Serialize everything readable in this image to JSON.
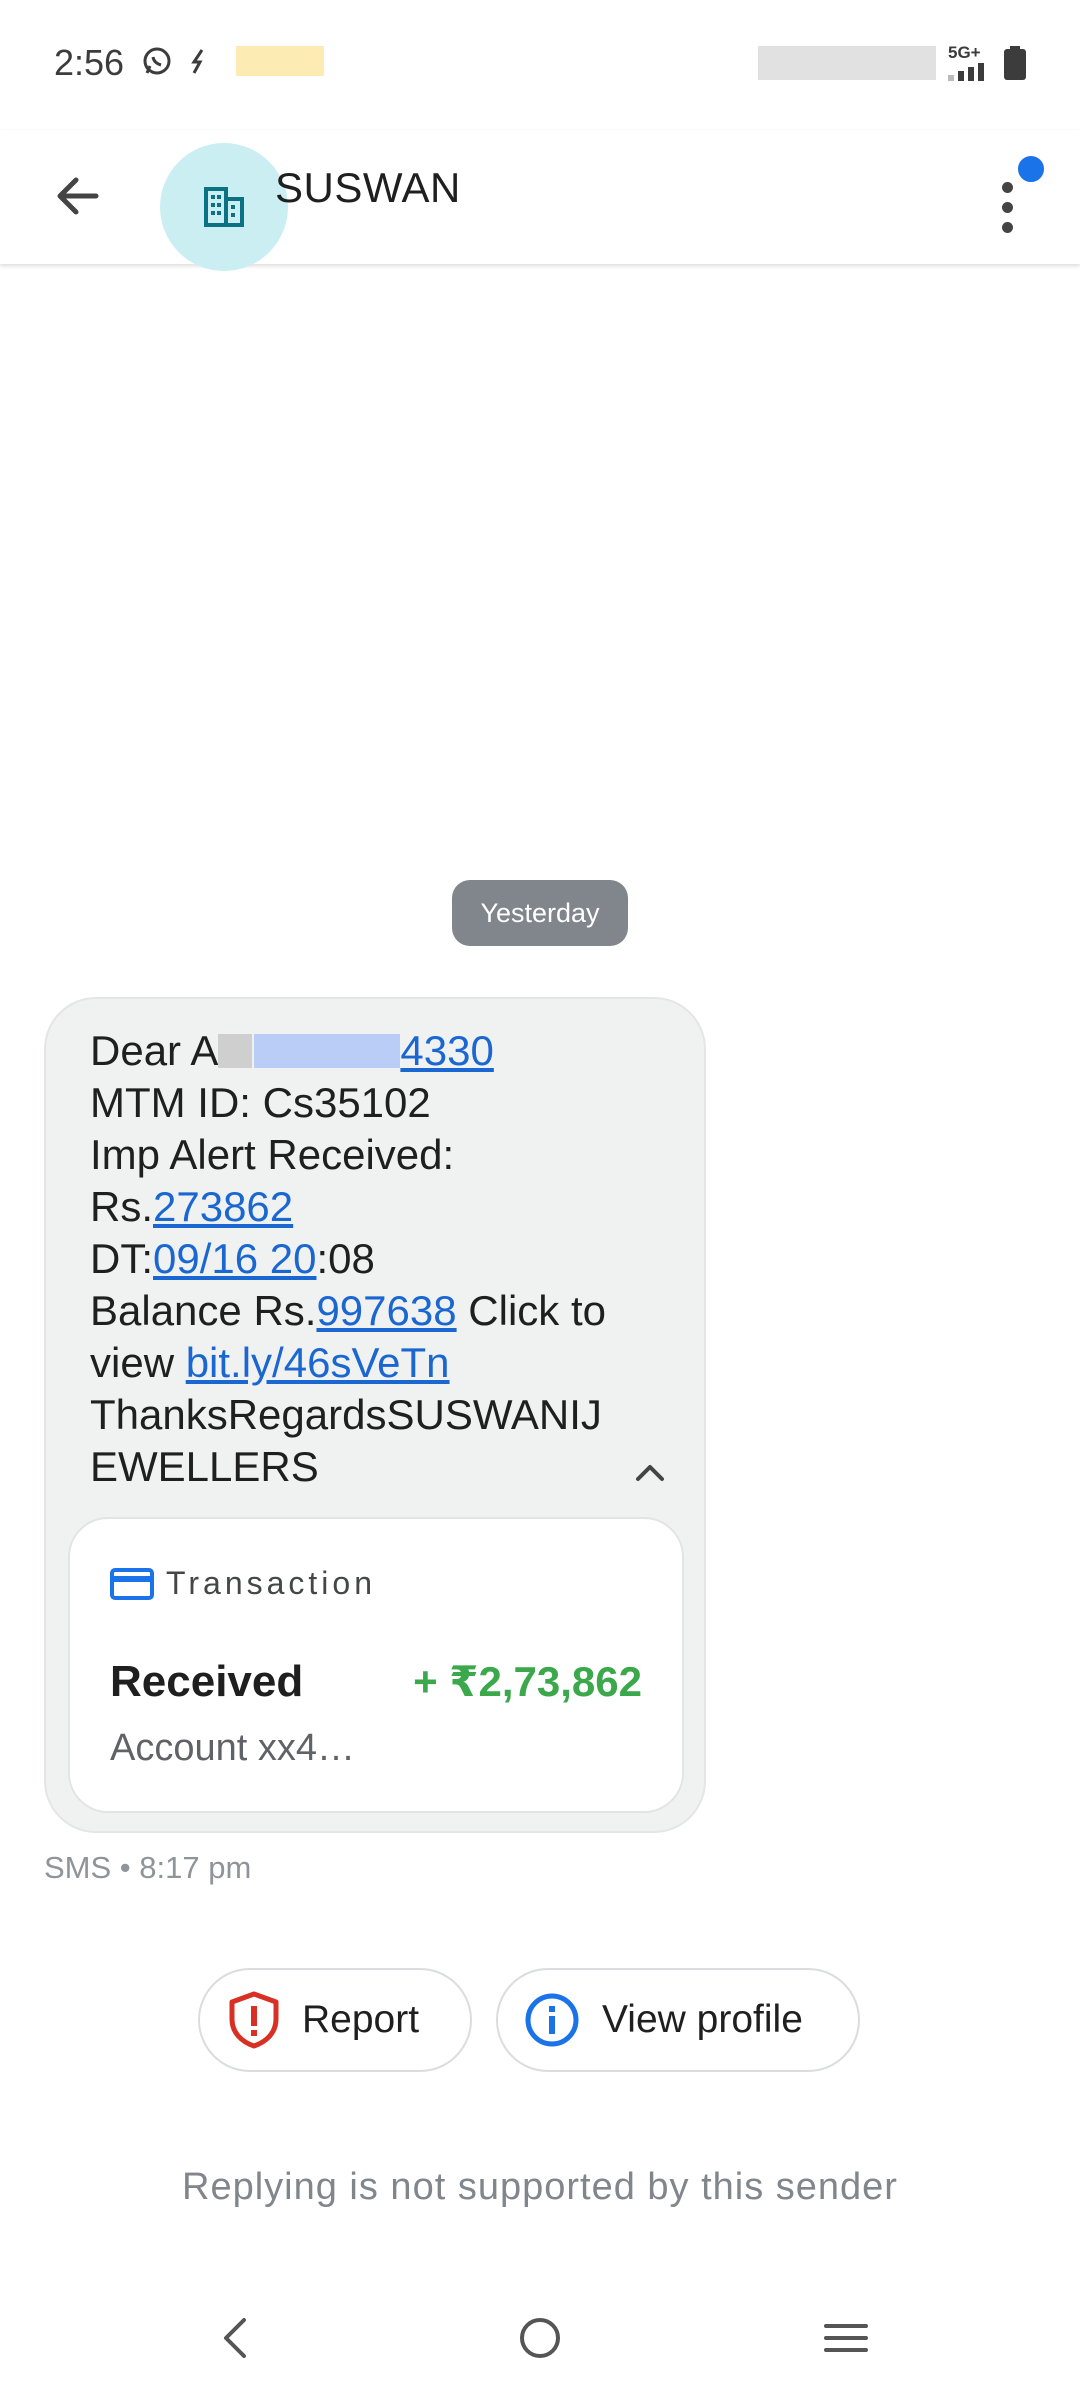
{
  "status_bar": {
    "time": "2:56",
    "network": "5G+",
    "icons": [
      "whatsapp-icon",
      "notification-icon",
      "signal-icon",
      "battery-icon"
    ]
  },
  "app_bar": {
    "title": "SUSWAN",
    "icons": [
      "back-arrow-icon",
      "business-icon",
      "more-vert-icon"
    ]
  },
  "conversation": {
    "date_chip": "Yesterday",
    "message": {
      "line1_prefix": "Dear A",
      "line1_link": "4330",
      "line2": "MTM ID: Cs35102",
      "line3": "Imp Alert Received:",
      "line4_prefix": "Rs.",
      "line4_link": "273862",
      "line5_prefix": "DT:",
      "line5_link": "09/16 20",
      "line5_suffix": ":08",
      "line6_prefix": "Balance Rs.",
      "line6_link": "997638",
      "line6_suffix": " Click to",
      "line7_prefix": "view ",
      "line7_link": "bit.ly/46sVeTn",
      "line8": "ThanksRegardsSUSWANIJ",
      "line9": "EWELLERS"
    },
    "card": {
      "title": "Transaction",
      "type": "Received",
      "amount": "+ ₹2,73,862",
      "account": "Account xx4…"
    },
    "meta": "SMS • 8:17 pm"
  },
  "actions": {
    "report": "Report",
    "view_profile": "View profile"
  },
  "footer_note": "Replying is not supported by this sender",
  "colors": {
    "link": "#1a67d2",
    "amount": "#3aa84b",
    "bubble": "#f0f1f1",
    "accent": "#1a73e8",
    "report_red": "#d93025"
  }
}
